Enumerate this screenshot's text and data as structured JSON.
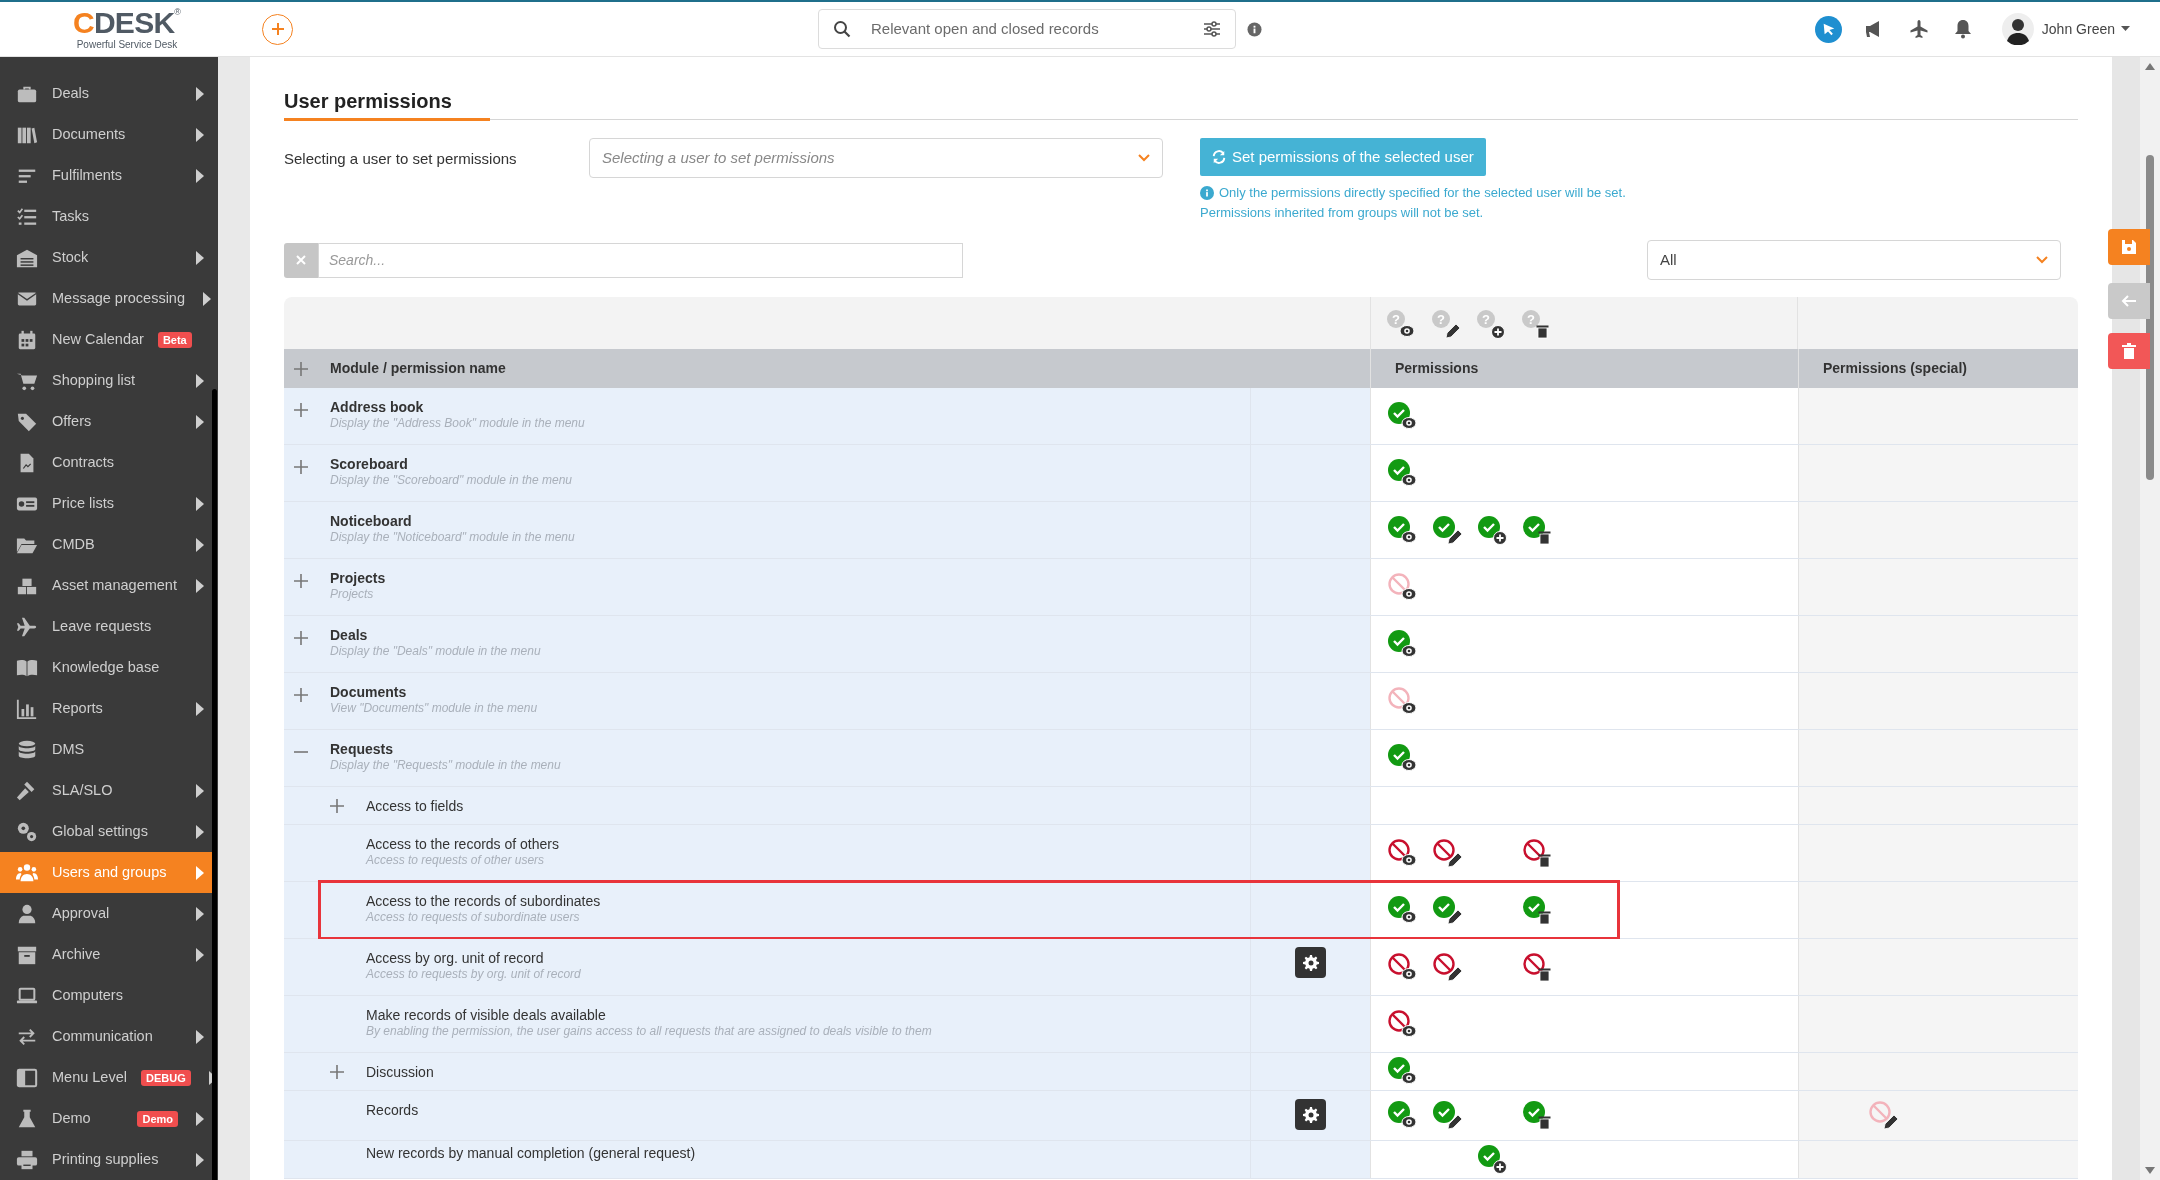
{
  "header": {
    "logo_accent": "C",
    "logo_rest": "DESK",
    "logo_mark": "®",
    "tagline": "Powerful Service Desk",
    "search": {
      "placeholder": "Relevant open and closed records"
    },
    "user": "John Green"
  },
  "sidebar": {
    "items": [
      {
        "label": "Deals",
        "arrow": true,
        "selected": false
      },
      {
        "label": "Documents",
        "arrow": true,
        "selected": false
      },
      {
        "label": "Fulfilments",
        "arrow": true,
        "selected": false
      },
      {
        "label": "Tasks",
        "arrow": false,
        "selected": false
      },
      {
        "label": "Stock",
        "arrow": true,
        "selected": false
      },
      {
        "label": "Message processing",
        "arrow": true,
        "selected": false
      },
      {
        "label": "New Calendar",
        "arrow": false,
        "selected": false,
        "badge": "Beta"
      },
      {
        "label": "Shopping list",
        "arrow": true,
        "selected": false
      },
      {
        "label": "Offers",
        "arrow": true,
        "selected": false
      },
      {
        "label": "Contracts",
        "arrow": false,
        "selected": false
      },
      {
        "label": "Price lists",
        "arrow": true,
        "selected": false
      },
      {
        "label": "CMDB",
        "arrow": true,
        "selected": false
      },
      {
        "label": "Asset management",
        "arrow": true,
        "selected": false
      },
      {
        "label": "Leave requests",
        "arrow": false,
        "selected": false
      },
      {
        "label": "Knowledge base",
        "arrow": false,
        "selected": false
      },
      {
        "label": "Reports",
        "arrow": true,
        "selected": false
      },
      {
        "label": "DMS",
        "arrow": false,
        "selected": false
      },
      {
        "label": "SLA/SLO",
        "arrow": true,
        "selected": false
      },
      {
        "label": "Global settings",
        "arrow": true,
        "selected": false
      },
      {
        "label": "Users and groups",
        "arrow": true,
        "selected": true
      },
      {
        "label": "Approval",
        "arrow": true,
        "selected": false
      },
      {
        "label": "Archive",
        "arrow": true,
        "selected": false
      },
      {
        "label": "Computers",
        "arrow": false,
        "selected": false
      },
      {
        "label": "Communication",
        "arrow": true,
        "selected": false
      },
      {
        "label": "Menu Level",
        "arrow": true,
        "selected": false,
        "badge": "DEBUG"
      },
      {
        "label": "Demo",
        "arrow": true,
        "selected": false,
        "badge": "Demo"
      },
      {
        "label": "Printing supplies",
        "arrow": true,
        "selected": false
      }
    ]
  },
  "page": {
    "title": "User permissions",
    "user_select_label": "Selecting a user to set permissions",
    "user_select": {
      "placeholder": "Selecting a user to set permissions"
    },
    "set_button": "Set permissions of the selected user",
    "info_lines": [
      "Only the permissions directly specified for the selected user will be set.",
      "Permissions inherited from groups will not be set."
    ],
    "search": {
      "placeholder": "Search..."
    },
    "filter": {
      "value": "All"
    }
  },
  "table": {
    "legend": [
      {
        "kind": "view",
        "mark": "?"
      },
      {
        "kind": "edit",
        "mark": "?"
      },
      {
        "kind": "add",
        "mark": "?"
      },
      {
        "kind": "delete",
        "mark": "?"
      }
    ],
    "columns": [
      "Module / permission name",
      "Permissions",
      "Permissions (special)"
    ],
    "rows": [
      {
        "name": "Address book",
        "description": "Display the \"Address Book\" module in the menu",
        "expandable": true,
        "expanded": false,
        "permissions": [
          {
            "kind": "view",
            "checked": true,
            "disabled": false
          }
        ]
      },
      {
        "name": "Scoreboard",
        "description": "Display the \"Scoreboard\" module in the menu",
        "expandable": true,
        "expanded": false,
        "permissions": [
          {
            "kind": "view",
            "checked": true,
            "disabled": false
          }
        ]
      },
      {
        "name": "Noticeboard",
        "description": "Display the \"Noticeboard\" module in the menu",
        "expandable": false,
        "permissions": [
          {
            "kind": "view",
            "checked": true,
            "disabled": false
          },
          {
            "kind": "edit",
            "checked": true,
            "disabled": false
          },
          {
            "kind": "add",
            "checked": true,
            "disabled": false
          },
          {
            "kind": "delete",
            "checked": true,
            "disabled": false
          }
        ]
      },
      {
        "name": "Projects",
        "description": "Projects",
        "expandable": true,
        "expanded": false,
        "permissions": [
          {
            "kind": "view",
            "checked": false,
            "disabled": true
          }
        ]
      },
      {
        "name": "Deals",
        "description": "Display the \"Deals\" module in the menu",
        "expandable": true,
        "expanded": false,
        "permissions": [
          {
            "kind": "view",
            "checked": true,
            "disabled": false
          }
        ]
      },
      {
        "name": "Documents",
        "description": "View \"Documents\" module in the menu",
        "expandable": true,
        "expanded": false,
        "permissions": [
          {
            "kind": "view",
            "checked": false,
            "disabled": true
          }
        ]
      },
      {
        "name": "Requests",
        "description": "Display the \"Requests\" module in the menu",
        "expandable": true,
        "expanded": true,
        "permissions": [
          {
            "kind": "view",
            "checked": true,
            "disabled": false
          }
        ],
        "children": [
          {
            "name": "Access to fields",
            "expandable": true,
            "expanded": false
          },
          {
            "name": "Access to the records of others",
            "description": "Access to requests of other users",
            "expandable": false,
            "permissions": [
              {
                "kind": "view",
                "checked": false,
                "disabled": false
              },
              {
                "kind": "edit",
                "checked": false,
                "disabled": false
              },
              {
                "kind": "delete",
                "checked": false,
                "disabled": false
              }
            ]
          },
          {
            "name": "Access to the records of subordinates",
            "description": "Access to requests of subordinate users",
            "expandable": false,
            "highlighted": true,
            "permissions": [
              {
                "kind": "view",
                "checked": true,
                "disabled": false
              },
              {
                "kind": "edit",
                "checked": true,
                "disabled": false
              },
              {
                "kind": "delete",
                "checked": true,
                "disabled": false
              }
            ]
          },
          {
            "name": "Access by org. unit of record",
            "description": "Access to requests by org. unit of record",
            "expandable": false,
            "settings": true,
            "permissions": [
              {
                "kind": "view",
                "checked": false,
                "disabled": false
              },
              {
                "kind": "edit",
                "checked": false,
                "disabled": false
              },
              {
                "kind": "delete",
                "checked": false,
                "disabled": false
              }
            ]
          },
          {
            "name": "Make records of visible deals available",
            "description": "By enabling the permission, the user gains access to all requests that are assigned to deals visible to them",
            "expandable": false,
            "permissions": [
              {
                "kind": "view",
                "checked": false,
                "disabled": false
              }
            ]
          },
          {
            "name": "Discussion",
            "expandable": true,
            "expanded": false,
            "permissions": [
              {
                "kind": "view",
                "checked": true,
                "disabled": false
              }
            ]
          },
          {
            "name": "Records",
            "expandable": false,
            "settings": true,
            "permissions": [
              {
                "kind": "view",
                "checked": true,
                "disabled": false
              },
              {
                "kind": "edit",
                "checked": true,
                "disabled": false
              },
              {
                "kind": "delete",
                "checked": true,
                "disabled": false
              }
            ],
            "special": [
              {
                "kind": "edit",
                "checked": false,
                "disabled": true
              }
            ]
          },
          {
            "name": "New records by manual completion (general request)",
            "expandable": false,
            "permissions": [
              {
                "kind": "add",
                "checked": true,
                "disabled": false
              }
            ]
          }
        ]
      }
    ]
  }
}
